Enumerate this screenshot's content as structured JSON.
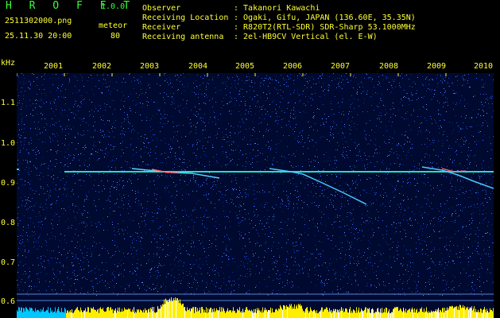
{
  "app": {
    "name": "H R O F F T",
    "version": "1.0.0"
  },
  "file": {
    "name": "2511302000.png",
    "datetime": "25.11.30 20:00"
  },
  "meteor": {
    "label": "meteor",
    "count": "80"
  },
  "info": [
    {
      "label": "Observer",
      "value": ": Takanori Kawachi"
    },
    {
      "label": "Receiving Location",
      "value": ": Ogaki, Gifu, JAPAN (136.60E, 35.35N)"
    },
    {
      "label": "Receiver",
      "value": ": R820T2(RTL-SDR) SDR-Sharp 53.1000MHz"
    },
    {
      "label": "Receiving antenna",
      "value": ": 2el-HB9CV Vertical (el. E-W)"
    }
  ],
  "yaxis": {
    "unit": "kHz",
    "ticks": [
      "1.1",
      "1.0",
      "0.9",
      "0.8",
      "0.7",
      "0.6"
    ]
  },
  "xaxis": {
    "ticks": [
      "2001",
      "2002",
      "2003",
      "2004",
      "2005",
      "2006",
      "2007",
      "2008",
      "2009",
      "2010"
    ]
  },
  "colors": {
    "text": "#ffff33",
    "logo": "#39ff39",
    "background": "#000a30",
    "carrier": "#22e0c0",
    "power": "#ffee00",
    "power_base": "#00c8ff"
  }
}
